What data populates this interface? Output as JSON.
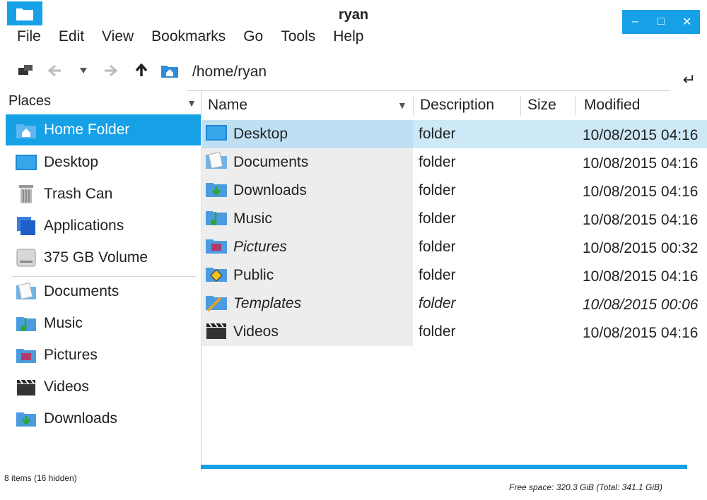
{
  "window": {
    "title": "ryan"
  },
  "menu": [
    "File",
    "Edit",
    "View",
    "Bookmarks",
    "Go",
    "Tools",
    "Help"
  ],
  "toolbar": {
    "path": "/home/ryan"
  },
  "sidebar": {
    "header": "Places",
    "items": [
      {
        "label": "Home Folder",
        "icon": "home-folder-icon",
        "active": true
      },
      {
        "label": "Desktop",
        "icon": "desktop-icon"
      },
      {
        "label": "Trash Can",
        "icon": "trash-icon"
      },
      {
        "label": "Applications",
        "icon": "applications-icon"
      },
      {
        "label": "375 GB Volume",
        "icon": "drive-icon"
      }
    ],
    "bookmarks": [
      {
        "label": "Documents",
        "icon": "documents-icon"
      },
      {
        "label": "Music",
        "icon": "music-folder-icon"
      },
      {
        "label": "Pictures",
        "icon": "pictures-folder-icon"
      },
      {
        "label": "Videos",
        "icon": "videos-folder-icon"
      },
      {
        "label": "Downloads",
        "icon": "downloads-folder-icon"
      }
    ]
  },
  "columns": {
    "name": "Name",
    "description": "Description",
    "size": "Size",
    "modified": "Modified"
  },
  "files": [
    {
      "name": "Desktop",
      "description": "folder",
      "modified": "10/08/2015 04:16",
      "icon": "desktop-icon",
      "selected": true
    },
    {
      "name": "Documents",
      "description": "folder",
      "modified": "10/08/2015 04:16",
      "icon": "documents-icon"
    },
    {
      "name": "Downloads",
      "description": "folder",
      "modified": "10/08/2015 04:16",
      "icon": "downloads-folder-icon"
    },
    {
      "name": "Music",
      "description": "folder",
      "modified": "10/08/2015 04:16",
      "icon": "music-folder-icon"
    },
    {
      "name": "Pictures",
      "description": "folder",
      "modified": "10/08/2015 00:32",
      "icon": "pictures-folder-icon"
    },
    {
      "name": "Public",
      "description": "folder",
      "modified": "10/08/2015 04:16",
      "icon": "public-folder-icon"
    },
    {
      "name": "Templates",
      "description": "folder",
      "modified": "10/08/2015 00:06",
      "icon": "templates-folder-icon"
    },
    {
      "name": "Videos",
      "description": "folder",
      "modified": "10/08/2015 04:16",
      "icon": "videos-folder-icon"
    }
  ],
  "status": {
    "items": "8 items (16 hidden)",
    "free_space": "Free space: 320.3 GiB (Total: 341.1 GiB)"
  },
  "colors": {
    "accent": "#16a1e7",
    "selection": "#cde8f7"
  }
}
